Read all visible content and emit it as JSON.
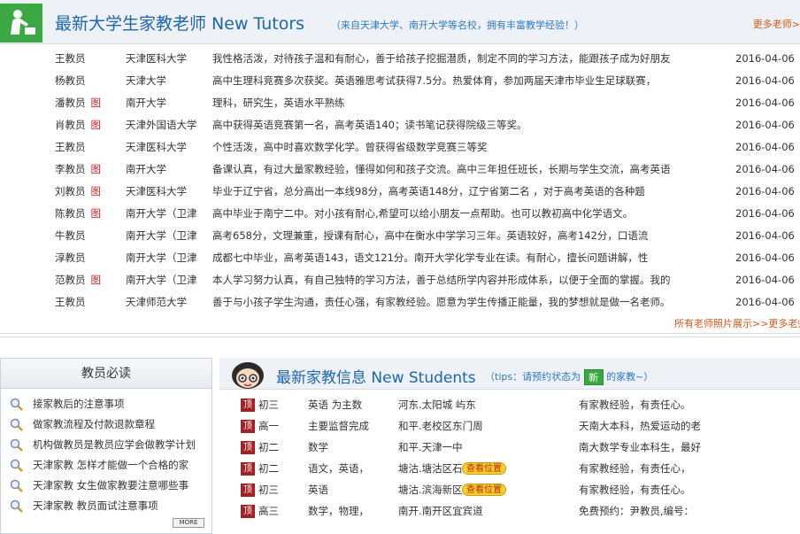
{
  "tutors": {
    "title": "最新大学生家教老师 New Tutors",
    "subtitle": "（来自天津大学、南开大学等名校，拥有丰富教学经验！）",
    "more_link": "更多老师>",
    "photo_tag": "图",
    "rows": [
      {
        "name": "王教员",
        "photo": false,
        "school": "天津医科大学",
        "desc": "我性格活泼，对待孩子温和有耐心，善于给孩子挖掘潜质，制定不同的学习方法，能跟孩子成为好朋友",
        "date": "2016-04-06"
      },
      {
        "name": "杨教员",
        "photo": false,
        "school": "天津大学",
        "desc": "高中生理科竞赛多次获奖。英语雅思考试获得7.5分。热爱体育，参加两届天津市毕业生足球联赛，",
        "date": "2016-04-06"
      },
      {
        "name": "潘教员",
        "photo": true,
        "school": "南开大学",
        "desc": "理科，研究生，英语水平熟练",
        "date": "2016-04-06"
      },
      {
        "name": "肖教员",
        "photo": true,
        "school": "天津外国语大学",
        "desc": "高中获得英语竞赛第一名，高考英语140；读书笔记获得院级三等奖。",
        "date": "2016-04-06"
      },
      {
        "name": "王教员",
        "photo": false,
        "school": "天津医科大学",
        "desc": "个性活泼，高中时喜欢数学化学。曾获得省级数学竞赛三等奖",
        "date": "2016-04-06"
      },
      {
        "name": "李教员",
        "photo": true,
        "school": "南开大学",
        "desc": "备课认真，有过大量家教经验，懂得如何和孩子交流。高中三年担任班长，长期与学生交流，高考英语",
        "date": "2016-04-06"
      },
      {
        "name": "刘教员",
        "photo": true,
        "school": "天津医科大学",
        "desc": "毕业于辽宁省，总分高出一本线98分，高考英语148分，辽宁省第二名 ，对于高考英语的各种题",
        "date": "2016-04-06"
      },
      {
        "name": "陈教员",
        "photo": true,
        "school": "南开大学（卫津",
        "desc": "高中毕业于南宁二中。对小孩有耐心,希望可以给小朋友一点帮助。也可以教初高中化学语文。",
        "date": "2016-04-06"
      },
      {
        "name": "牛教员",
        "photo": false,
        "school": "南开大学（卫津",
        "desc": "高考658分，文理兼重，授课有耐心，高中在衡水中学学习三年。英语较好，高考142分，口语流",
        "date": "2016-04-06"
      },
      {
        "name": "淳教员",
        "photo": false,
        "school": "南开大学（卫津",
        "desc": "成都七中毕业，高考英语143，语文121分。南开大学化学专业在读。有耐心，擅长问题讲解，性",
        "date": "2016-04-06"
      },
      {
        "name": "范教员",
        "photo": true,
        "school": "南开大学（卫津",
        "desc": "本人学习努力认真，有自己独特的学习方法，善于总结所学内容并形成体系，以便于全面的掌握。我的",
        "date": "2016-04-06"
      },
      {
        "name": "王教员",
        "photo": false,
        "school": "天津师范大学",
        "desc": "善于与小孩子学生沟通，责任心强，有家教经验。愿意为学生传播正能量，我的梦想就是做一名老师。",
        "date": "2016-04-06"
      }
    ],
    "photo_link": "所有老师照片展示>>更多老师"
  },
  "guide": {
    "title": "教员必读",
    "items": [
      "接家教后的注意事项",
      "做家教流程及付款退款章程",
      "机构做教员是教员应学会做教学计划",
      "天津家教 怎样才能做一个合格的家",
      "天津家教 女生做家教要注意哪些事",
      "天津家教 教员面试注意事项"
    ],
    "more": "MORE"
  },
  "students": {
    "title": "最新家教信息 New Students",
    "tips_prefix": "（tips：请预约状态为",
    "tips_suffix": "的家教~）",
    "new_label": "新",
    "top_label": "顶",
    "rows": [
      {
        "grade": "初三",
        "subject": "英语 为主数",
        "address": "河东.太阳城 屿东",
        "location": "",
        "req": "有家教经验，有责任心。"
      },
      {
        "grade": "高一",
        "subject": "主要监督完成",
        "address": "和平.老校区东门周",
        "location": "",
        "req": "天南大本科，热爱运动的老"
      },
      {
        "grade": "初二",
        "subject": "数学",
        "address": "和平.天津一中",
        "location": "",
        "req": "南大数学专业本科生，最好"
      },
      {
        "grade": "初二",
        "subject": "语文，英语，",
        "address": "塘沽.塘沽区石油新",
        "location": "查看位置",
        "req": "有家教经验，有责任心，"
      },
      {
        "grade": "初三",
        "subject": "英语",
        "address": "塘沽.滨海新区中新",
        "location": "查看位置",
        "req": "有家教经验，有责任心。"
      },
      {
        "grade": "高三",
        "subject": "数学，物理，",
        "address": "南开.南开区宜宾道",
        "location": "",
        "req": "免费预约：尹教员,编号："
      }
    ]
  }
}
